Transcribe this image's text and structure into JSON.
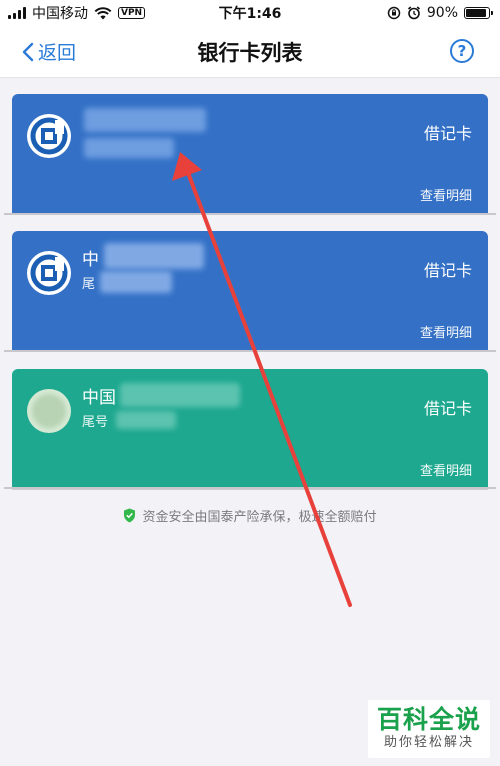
{
  "status_bar": {
    "carrier": "中国移动",
    "vpn": "VPN",
    "time": "下午1:46",
    "battery": "90%"
  },
  "nav": {
    "back_label": "返回",
    "title": "银行卡列表",
    "help_symbol": "?"
  },
  "cards": [
    {
      "bank_name": "",
      "tail": "",
      "type": "借记卡",
      "detail_label": "查看明细",
      "color": "#3471c6"
    },
    {
      "bank_name": "中",
      "tail": "尾",
      "type": "借记卡",
      "detail_label": "查看明细",
      "color": "#3471c6"
    },
    {
      "bank_name": "中国",
      "tail": "尾号",
      "type": "借记卡",
      "detail_label": "查看明细",
      "color": "#1ea88f"
    }
  ],
  "notice": {
    "icon": "shield-check-icon",
    "text": "资金安全由国泰产险承保，极速全额赔付"
  },
  "watermark": {
    "main": "百科全说",
    "sub": "助你轻松解决"
  },
  "colors": {
    "accent": "#2a7bd7",
    "card_blue": "#3471c6",
    "card_green": "#1ea88f",
    "arrow": "#e8413b",
    "watermark_green": "#1aa14b"
  }
}
